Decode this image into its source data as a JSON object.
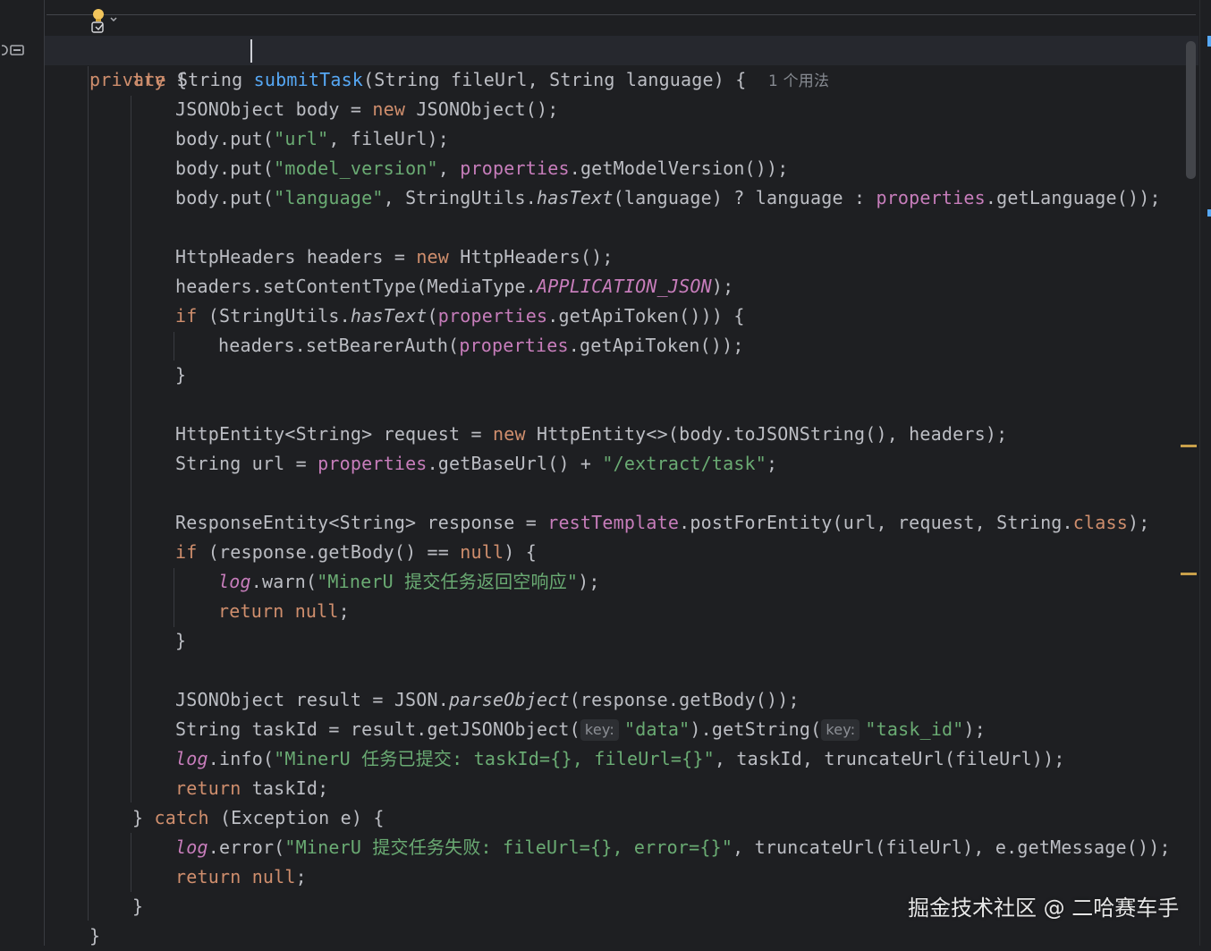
{
  "editor": {
    "header": {
      "keyword_private": "private",
      "type_string": "String",
      "method_name": "submitTask",
      "params": "(String fileUrl, String language) {",
      "usages": "1 个用法"
    },
    "lines": {
      "l2_try": "try",
      "l2_brace": " {",
      "l3_a": "JSONObject body = ",
      "l3_new": "new",
      "l3_b": " JSONObject();",
      "l4_a": "body.put(",
      "l4_str": "\"url\"",
      "l4_b": ", fileUrl);",
      "l5_a": "body.put(",
      "l5_str": "\"model_version\"",
      "l5_b": ", ",
      "l5_fld": "properties",
      "l5_c": ".getModelVersion());",
      "l6_a": "body.put(",
      "l6_str": "\"language\"",
      "l6_b": ", StringUtils.",
      "l6_it": "hasText",
      "l6_c": "(language) ? language : ",
      "l6_fld": "properties",
      "l6_d": ".getLanguage());",
      "l8_a": "HttpHeaders headers = ",
      "l8_new": "new",
      "l8_b": " HttpHeaders();",
      "l9_a": "headers.setContentType(MediaType.",
      "l9_const": "APPLICATION_JSON",
      "l9_b": ");",
      "l10_if": "if",
      "l10_a": " (StringUtils.",
      "l10_it": "hasText",
      "l10_b": "(",
      "l10_fld": "properties",
      "l10_c": ".getApiToken())) {",
      "l11_a": "headers.setBearerAuth(",
      "l11_fld": "properties",
      "l11_b": ".getApiToken());",
      "l12": "}",
      "l14_a": "HttpEntity<String> request = ",
      "l14_new": "new",
      "l14_b": " HttpEntity<>(body.toJSONString(), headers);",
      "l15_a": "String url = ",
      "l15_fld": "properties",
      "l15_b": ".getBaseUrl() + ",
      "l15_str": "\"/extract/task\"",
      "l15_c": ";",
      "l17_a": "ResponseEntity<String> response = ",
      "l17_fld": "restTemplate",
      "l17_b": ".postForEntity(url, request, String.",
      "l17_cls": "class",
      "l17_c": ");",
      "l18_if": "if",
      "l18_a": " (response.getBody() == ",
      "l18_null": "null",
      "l18_b": ") {",
      "l19_log": "log",
      "l19_a": ".warn(",
      "l19_str": "\"MinerU 提交任务返回空响应\"",
      "l19_b": ");",
      "l20_ret": "return",
      "l20_null": " null",
      "l20_b": ";",
      "l21": "}",
      "l23_a": "JSONObject result = JSON.",
      "l23_it": "parseObject",
      "l23_b": "(response.getBody());",
      "l24_a": "String taskId = result.getJSONObject(",
      "l24_hint": "key:",
      "l24_str": "\"data\"",
      "l24_b": ").getString(",
      "l24_hint2": "key:",
      "l24_str2": "\"task_id\"",
      "l24_c": ");",
      "l25_log": "log",
      "l25_a": ".info(",
      "l25_str": "\"MinerU 任务已提交: taskId={}, fileUrl={}\"",
      "l25_b": ", taskId, truncateUrl(fileUrl));",
      "l26_ret": "return",
      "l26_a": " taskId;",
      "l27_a": "} ",
      "l27_catch": "catch",
      "l27_b": " (Exception e) {",
      "l28_log": "log",
      "l28_a": ".error(",
      "l28_str": "\"MinerU 提交任务失败: fileUrl={}, error={}\"",
      "l28_b": ", truncateUrl(fileUrl), e.getMessage());",
      "l29_ret": "return",
      "l29_null": " null",
      "l29_b": ";",
      "l30": "}",
      "l31": "}"
    }
  },
  "watermark": "掘金技术社区 @ 二哈赛车手",
  "icons": {
    "bulb": "lightbulb-icon",
    "gutter": "method-icon"
  },
  "colors": {
    "background": "#1e1f22",
    "keyword": "#cf8e6d",
    "function": "#56a8f5",
    "string": "#6aab73",
    "field": "#c77dbb",
    "text": "#bcbec4"
  }
}
